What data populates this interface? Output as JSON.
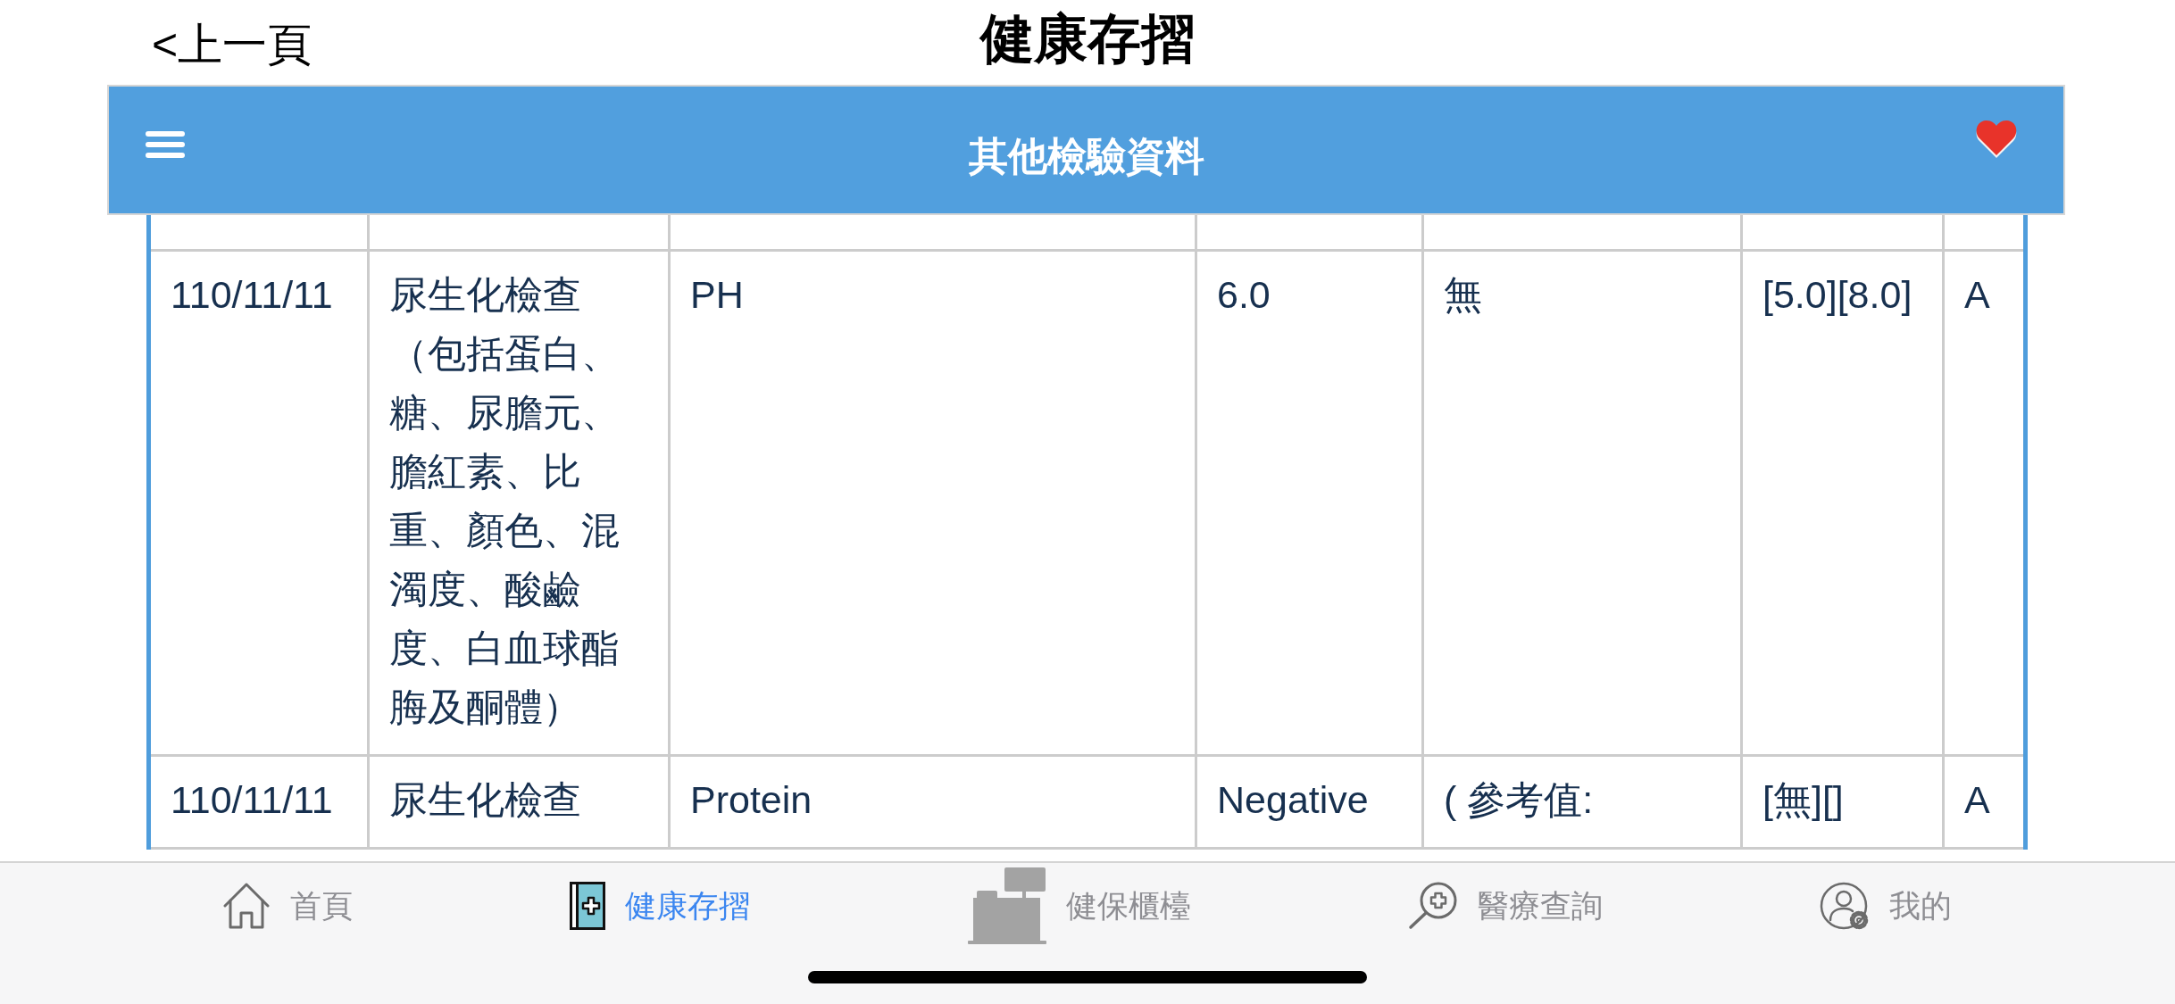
{
  "nav_bar": {
    "back": "<上一頁",
    "title": "健康存摺"
  },
  "header": {
    "title": "其他檢驗資料"
  },
  "table": {
    "rows": [
      {
        "cells": [
          "110/11/11",
          "尿生化檢查（包括蛋白、糖、尿膽元、膽紅素、比重、顏色、混濁度、酸鹼度、白血球酯脢及酮體）",
          "PH",
          "6.0",
          "無",
          "[5.0][8.0]",
          "A"
        ]
      },
      {
        "cells": [
          "110/11/11",
          "尿生化檢查",
          "Protein",
          "Negative",
          "( 參考值:",
          "[無][]",
          "A"
        ]
      }
    ]
  },
  "tab_bar": {
    "items": [
      {
        "label": "首頁",
        "selected": false
      },
      {
        "label": "健康存摺",
        "selected": true
      },
      {
        "label": "健保櫃檯",
        "selected": false
      },
      {
        "label": "醫療查詢",
        "selected": false
      },
      {
        "label": "我的",
        "selected": false
      }
    ]
  }
}
